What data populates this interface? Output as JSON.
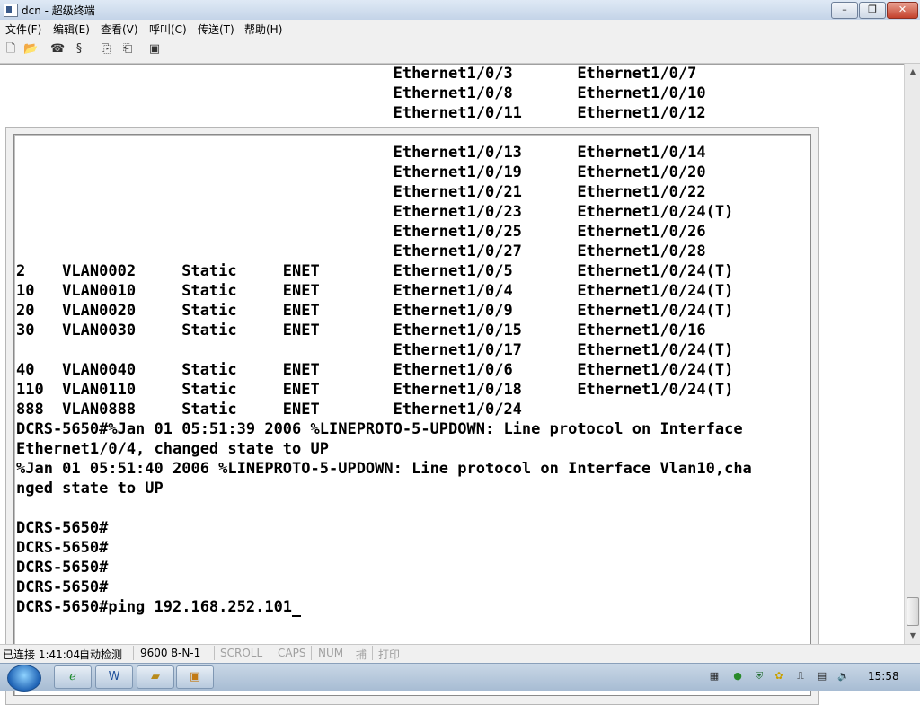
{
  "window": {
    "title": "dcn - 超级终端",
    "minimize": "0",
    "maximize": "1",
    "close": "r"
  },
  "menu": [
    "文件(F)",
    "编辑(E)",
    "查看(V)",
    "呼叫(C)",
    "传送(T)",
    "帮助(H)"
  ],
  "toolbar": {
    "icons": [
      "new-icon",
      "open-icon",
      "phone-icon",
      "disconnect-icon",
      "send-icon",
      "receive-icon",
      "properties-icon"
    ]
  },
  "terminal": {
    "lines": [
      "                                         Ethernet1/0/3       Ethernet1/0/7",
      "                                         Ethernet1/0/8       Ethernet1/0/10",
      "                                         Ethernet1/0/11      Ethernet1/0/12",
      "",
      "                                         Ethernet1/0/13      Ethernet1/0/14",
      "                                         Ethernet1/0/19      Ethernet1/0/20",
      "                                         Ethernet1/0/21      Ethernet1/0/22",
      "                                         Ethernet1/0/23      Ethernet1/0/24(T)",
      "                                         Ethernet1/0/25      Ethernet1/0/26",
      "                                         Ethernet1/0/27      Ethernet1/0/28",
      "2    VLAN0002     Static     ENET        Ethernet1/0/5       Ethernet1/0/24(T)",
      "10   VLAN0010     Static     ENET        Ethernet1/0/4       Ethernet1/0/24(T)",
      "20   VLAN0020     Static     ENET        Ethernet1/0/9       Ethernet1/0/24(T)",
      "30   VLAN0030     Static     ENET        Ethernet1/0/15      Ethernet1/0/16",
      "                                         Ethernet1/0/17      Ethernet1/0/24(T)",
      "40   VLAN0040     Static     ENET        Ethernet1/0/6       Ethernet1/0/24(T)",
      "110  VLAN0110     Static     ENET        Ethernet1/0/18      Ethernet1/0/24(T)",
      "888  VLAN0888     Static     ENET        Ethernet1/0/24",
      "DCRS-5650#%Jan 01 05:51:39 2006 %LINEPROTO-5-UPDOWN: Line protocol on Interface",
      "Ethernet1/0/4, changed state to UP",
      "%Jan 01 05:51:40 2006 %LINEPROTO-5-UPDOWN: Line protocol on Interface Vlan10,cha",
      "nged state to UP",
      "",
      "DCRS-5650#",
      "DCRS-5650#",
      "DCRS-5650#",
      "DCRS-5650#",
      "DCRS-5650#ping 192.168.252.101"
    ]
  },
  "status": {
    "connected": "已连接 1:41:04",
    "detect": "自动检测",
    "params": "9600 8-N-1",
    "scroll": "SCROLL",
    "caps": "CAPS",
    "num": "NUM",
    "capture": "捕",
    "print": "打印"
  },
  "taskbar": {
    "apps": [
      "ie-icon",
      "word-icon",
      "folder-icon",
      "hyperterminal-icon"
    ],
    "tray": [
      "network-icon",
      "security-icon",
      "shield-icon",
      "update-icon",
      "usb-icon",
      "sound-icon"
    ],
    "clock": "15:58"
  }
}
